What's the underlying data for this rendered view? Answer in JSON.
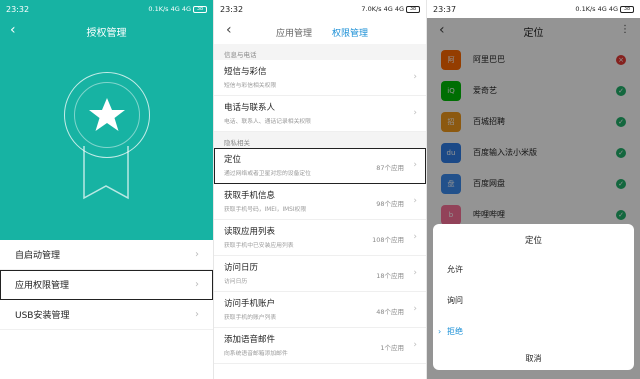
{
  "panel1": {
    "status": {
      "time": "23:32",
      "net": "0.1K/s",
      "signal": "4G 4G",
      "battery": "38"
    },
    "title": "授权管理",
    "menu": [
      {
        "label": "自启动管理"
      },
      {
        "label": "应用权限管理"
      },
      {
        "label": "USB安装管理"
      }
    ]
  },
  "panel2": {
    "status": {
      "time": "23:32",
      "net": "7.0K/s",
      "signal": "4G 4G",
      "battery": "38"
    },
    "tabs": {
      "left": "应用管理",
      "right": "权限管理"
    },
    "section_top": "信息与电话",
    "items_top": [
      {
        "title": "短信与彩信",
        "sub": "短信与彩信相关权限"
      },
      {
        "title": "电话与联系人",
        "sub": "电话、联系人、通话记录相关权限"
      }
    ],
    "section_privacy": "隐私相关",
    "items_privacy": [
      {
        "title": "定位",
        "sub": "通过网络或者卫星对您的设备定位",
        "count": "87个应用"
      },
      {
        "title": "获取手机信息",
        "sub": "获取手机号码，IMEI，IMSI权限",
        "count": "98个应用"
      },
      {
        "title": "读取应用列表",
        "sub": "获取手机中已安装应用列表",
        "count": "108个应用"
      },
      {
        "title": "访问日历",
        "sub": "访问日历",
        "count": "18个应用"
      },
      {
        "title": "访问手机账户",
        "sub": "获取手机的账户列表",
        "count": "48个应用"
      },
      {
        "title": "添加语音邮件",
        "sub": "向系统语音邮箱添加邮件",
        "count": "1个应用"
      }
    ]
  },
  "panel3": {
    "status": {
      "time": "23:37",
      "net": "0.1K/s",
      "signal": "4G 4G",
      "battery": "38"
    },
    "title": "定位",
    "apps": [
      {
        "name": "阿里巴巴",
        "icon_color": "#ff6a00",
        "icon_text": "阿",
        "status": "deny",
        "status_color": "#e53935"
      },
      {
        "name": "爱奇艺",
        "icon_color": "#00be06",
        "icon_text": "iQ",
        "status": "allow",
        "status_color": "#21b26b"
      },
      {
        "name": "百城招聘",
        "icon_color": "#f29a1c",
        "icon_text": "招",
        "status": "allow",
        "status_color": "#21b26b"
      },
      {
        "name": "百度输入法小米版",
        "icon_color": "#2f7fe8",
        "icon_text": "du",
        "status": "allow",
        "status_color": "#21b26b"
      },
      {
        "name": "百度网盘",
        "icon_color": "#3b8cf0",
        "icon_text": "盘",
        "status": "allow",
        "status_color": "#21b26b"
      },
      {
        "name": "哔哩哔哩",
        "icon_color": "#fb7299",
        "icon_text": "b",
        "status": "allow",
        "status_color": "#21b26b"
      }
    ],
    "dialog": {
      "title": "定位",
      "options": [
        "允许",
        "询问",
        "拒绝"
      ],
      "selected": "拒绝",
      "cancel": "取消"
    }
  }
}
